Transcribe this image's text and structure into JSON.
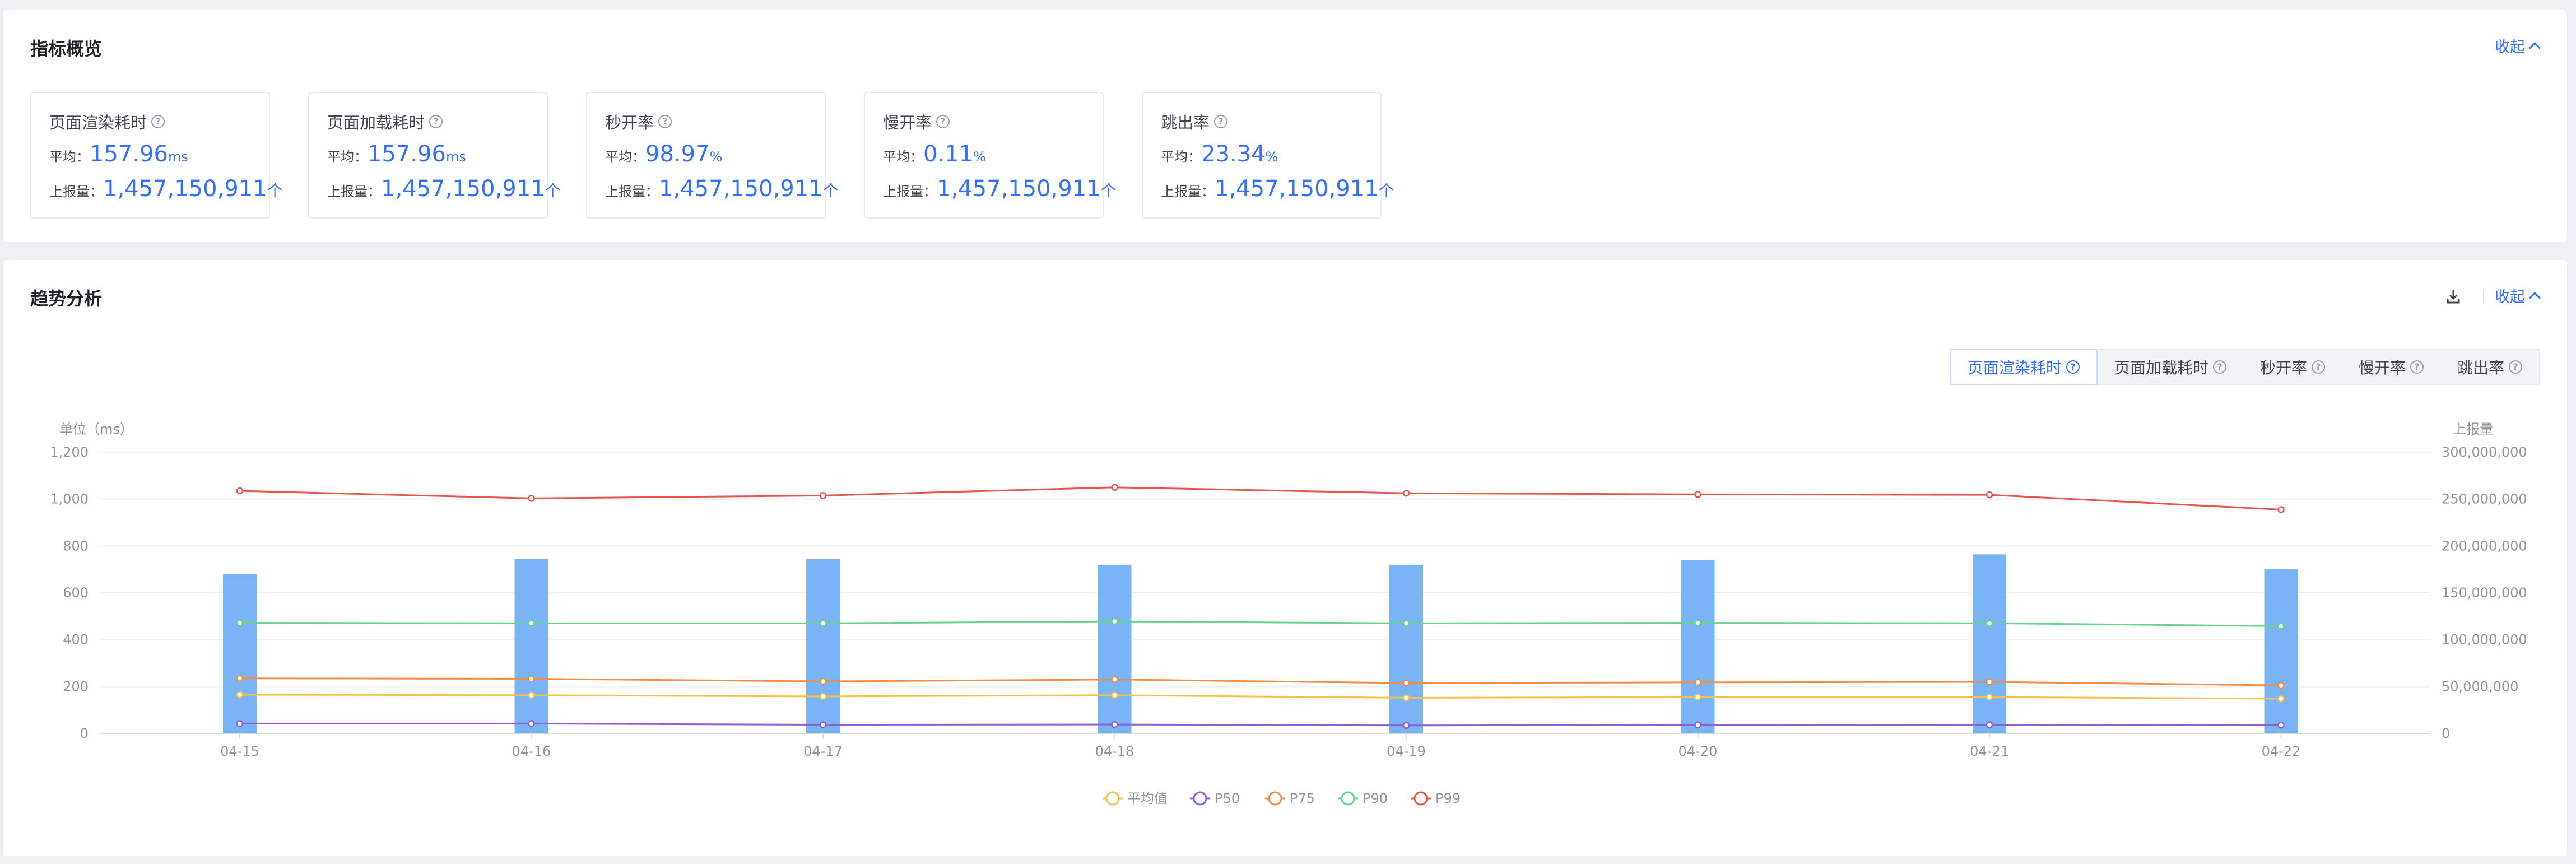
{
  "overview": {
    "title": "指标概览",
    "collapse_label": "收起",
    "metrics": [
      {
        "name": "页面渲染耗时",
        "avg_label": "平均：",
        "avg_value": "157.96",
        "avg_unit": "ms",
        "count_label": "上报量：",
        "count_value": "1,457,150,911",
        "count_unit": "个"
      },
      {
        "name": "页面加载耗时",
        "avg_label": "平均：",
        "avg_value": "157.96",
        "avg_unit": "ms",
        "count_label": "上报量：",
        "count_value": "1,457,150,911",
        "count_unit": "个"
      },
      {
        "name": "秒开率",
        "avg_label": "平均：",
        "avg_value": "98.97",
        "avg_unit": "%",
        "count_label": "上报量：",
        "count_value": "1,457,150,911",
        "count_unit": "个"
      },
      {
        "name": "慢开率",
        "avg_label": "平均：",
        "avg_value": "0.11",
        "avg_unit": "%",
        "count_label": "上报量：",
        "count_value": "1,457,150,911",
        "count_unit": "个"
      },
      {
        "name": "跳出率",
        "avg_label": "平均：",
        "avg_value": "23.34",
        "avg_unit": "%",
        "count_label": "上报量：",
        "count_value": "1,457,150,911",
        "count_unit": "个"
      }
    ]
  },
  "trend": {
    "title": "趋势分析",
    "collapse_label": "收起",
    "download_icon": "download-icon",
    "tabs": [
      {
        "label": "页面渲染耗时",
        "active": true
      },
      {
        "label": "页面加载耗时",
        "active": false
      },
      {
        "label": "秒开率",
        "active": false
      },
      {
        "label": "慢开率",
        "active": false
      },
      {
        "label": "跳出率",
        "active": false
      }
    ]
  },
  "colors": {
    "accent": "#3370ff",
    "bar": "#78b4f6",
    "avg": "#f5c14b",
    "p50": "#8f5ed8",
    "p75": "#f28d43",
    "p90": "#67d48a",
    "p99": "#e5554a"
  },
  "chart_data": {
    "type": "bar+line",
    "title": "",
    "ylabel": "单位（ms）",
    "y2label": "上报量",
    "ylim": [
      0,
      1200
    ],
    "yticks": [
      0,
      200,
      400,
      600,
      800,
      1000,
      1200
    ],
    "y2lim": [
      0,
      300000000
    ],
    "y2ticks": [
      0,
      50000000,
      100000000,
      150000000,
      200000000,
      250000000,
      300000000
    ],
    "y2tick_labels": [
      "0",
      "50,000,000",
      "100,000,000",
      "150,000,000",
      "200,000,000",
      "250,000,000",
      "300,000,000"
    ],
    "categories": [
      "04-15",
      "04-16",
      "04-17",
      "04-18",
      "04-19",
      "04-20",
      "04-21",
      "04-22"
    ],
    "bars": {
      "axis": "right",
      "values": [
        170000000,
        186000000,
        186000000,
        180000000,
        180000000,
        185000000,
        191000000,
        175000000
      ]
    },
    "series": [
      {
        "name": "平均值",
        "color_key": "avg",
        "values": [
          165,
          163,
          158,
          163,
          152,
          155,
          155,
          148
        ]
      },
      {
        "name": "P50",
        "color_key": "p50",
        "values": [
          42,
          42,
          37,
          38,
          34,
          36,
          37,
          35
        ]
      },
      {
        "name": "P75",
        "color_key": "p75",
        "values": [
          235,
          233,
          222,
          230,
          215,
          218,
          220,
          205
        ]
      },
      {
        "name": "P90",
        "color_key": "p90",
        "values": [
          472,
          470,
          470,
          478,
          470,
          472,
          470,
          458
        ]
      },
      {
        "name": "P99",
        "color_key": "p99",
        "values": [
          1035,
          1003,
          1015,
          1050,
          1025,
          1020,
          1018,
          955
        ]
      }
    ],
    "grid": true,
    "legend_position": "bottom-center"
  }
}
